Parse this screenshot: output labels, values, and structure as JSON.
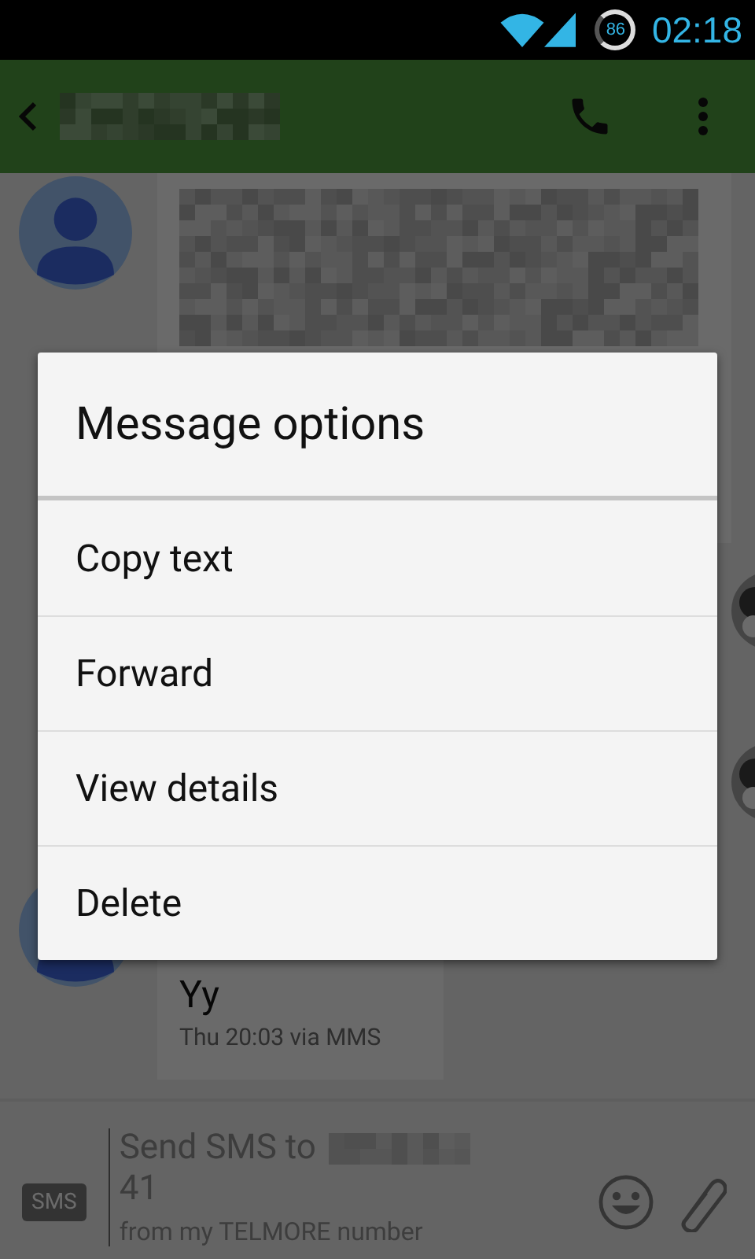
{
  "status_bar": {
    "battery": "86",
    "time": "02:18"
  },
  "conversation": {
    "messages": [
      {
        "kind": "incoming_redacted"
      },
      {
        "kind": "outgoing_avatar"
      },
      {
        "kind": "outgoing_avatar"
      },
      {
        "kind": "incoming",
        "text": "Yy",
        "meta": "Thu 20:03 via MMS"
      }
    ]
  },
  "composer": {
    "badge": "SMS",
    "placeholder_start": "Send SMS to",
    "placeholder_end": "41",
    "hint": "from my TELMORE number"
  },
  "dialog": {
    "title": "Message options",
    "items": [
      "Copy text",
      "Forward",
      "View details",
      "Delete"
    ]
  }
}
